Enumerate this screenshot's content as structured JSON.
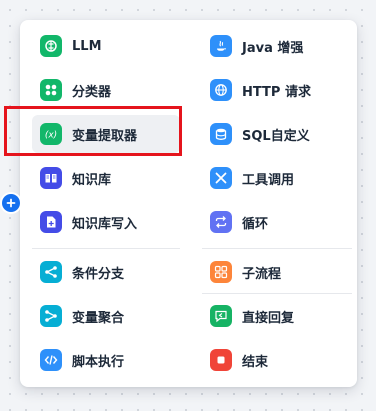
{
  "left_column": [
    {
      "label": "LLM",
      "icon": "brain-icon",
      "color": "#12b76a"
    },
    {
      "label": "分类器",
      "icon": "grid-icon",
      "color": "#12b76a"
    },
    {
      "label": "变量提取器",
      "icon": "variable-icon",
      "color": "#12b76a"
    },
    {
      "label": "知识库",
      "icon": "book-icon",
      "color": "#444ce7"
    },
    {
      "label": "知识库写入",
      "icon": "file-add-icon",
      "color": "#444ce7"
    },
    {
      "label": "条件分支",
      "icon": "branch-icon",
      "color": "#06aed4"
    },
    {
      "label": "变量聚合",
      "icon": "merge-icon",
      "color": "#06aed4"
    },
    {
      "label": "脚本执行",
      "icon": "code-icon",
      "color": "#2e90fa"
    }
  ],
  "right_column": [
    {
      "label": "Java 增强",
      "icon": "java-icon",
      "color": "#2e90fa"
    },
    {
      "label": "HTTP 请求",
      "icon": "globe-icon",
      "color": "#2e90fa"
    },
    {
      "label": "SQL自定义",
      "icon": "database-icon",
      "color": "#2e90fa"
    },
    {
      "label": "工具调用",
      "icon": "wrench-icon",
      "color": "#2e90fa"
    },
    {
      "label": "循环",
      "icon": "loop-icon",
      "color": "#6172f3"
    },
    {
      "label": "子流程",
      "icon": "subflow-icon",
      "color": "#fd853a"
    },
    {
      "label": "直接回复",
      "icon": "reply-icon",
      "color": "#16b364"
    },
    {
      "label": "结束",
      "icon": "stop-icon",
      "color": "#f04438"
    }
  ]
}
